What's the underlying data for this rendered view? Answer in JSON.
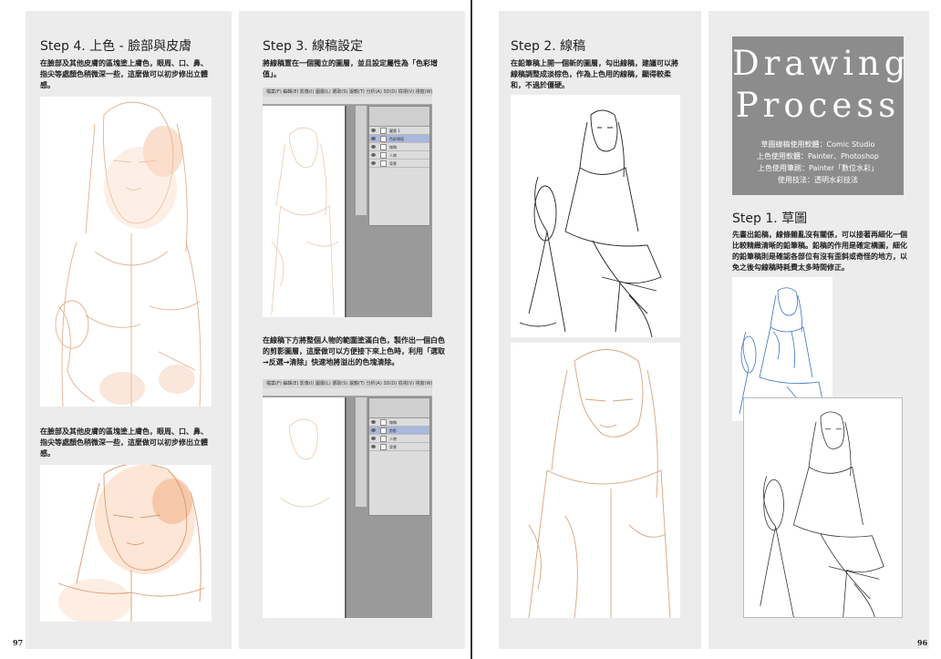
{
  "left_page": {
    "page_number": "97",
    "step4": {
      "title": "Step 4. 上色 - 臉部與皮膚",
      "text1": "在臉部及其他皮膚的區塊塗上膚色，眼周、口、鼻、指尖等處顏色稍微深一些，這麼做可以初步修出立體感。",
      "text2": "在臉部及其他皮膚的區塊塗上膚色，眼周、口、鼻、指尖等處顏色稍微深一些，這麼做可以初步修出立體感。"
    },
    "step3": {
      "title": "Step 3. 線稿設定",
      "text1": "將線稿置在一個獨立的圖層，並且設定屬性為「色彩增值」。",
      "text2": "在線稿下方將整個人物的範圍塗滿白色，製作出一個白色的剪影圖層，這麼做可以方便接下來上色時，利用「選取→反選→清除」快速地將溢出的色塊清除。"
    }
  },
  "right_page": {
    "page_number": "96",
    "step2": {
      "title": "Step 2. 線稿",
      "text": "在鉛筆稿上開一個新的圖層，勾出線稿，建議可以將線稿調整成淡棕色，作為上色用的線稿，顯得較柔和，不過於僵硬。"
    },
    "header": {
      "title_line1": "Drawing",
      "title_line2": "Process",
      "info": [
        "草圖線稿使用軟體：Comic Studio",
        "上色使用軟體：Painter、Photoshop",
        "上色使用筆刷：Painter「數位水彩」",
        "使用技法：透明水彩技法"
      ]
    },
    "step1": {
      "title": "Step 1. 草圖",
      "text": "先畫出鉛稿，線條雜亂沒有關係，可以接著再細化一個比較精緻清晰的鉛筆稿。鉛稿的作用是確定構圖，細化的鉛筆稿則是確認各部位有沒有歪斜或奇怪的地方，以免之後勾線稿時耗費太多時間修正。"
    }
  },
  "ps_window": {
    "menu": "檔案(F)  編輯(E)  影像(I)  圖層(L)  選取(S)  濾鏡(T)  分析(A)  3D(D)  檢視(V)  視窗(W)  說明(H)",
    "layers_top": [
      "圖層 1",
      "色彩增值",
      "線稿",
      "人物",
      "背景"
    ],
    "layers_bottom": [
      "線稿",
      "剪影",
      "人物",
      "背景"
    ]
  },
  "colors": {
    "column_bg": "#ececec",
    "title_box_bg": "#8c8c8c",
    "lineart_brown": "#d9a47c",
    "sketch_blue": "#3b73c4",
    "ink_black": "#222222",
    "selected_layer": "#a9b8dc"
  }
}
